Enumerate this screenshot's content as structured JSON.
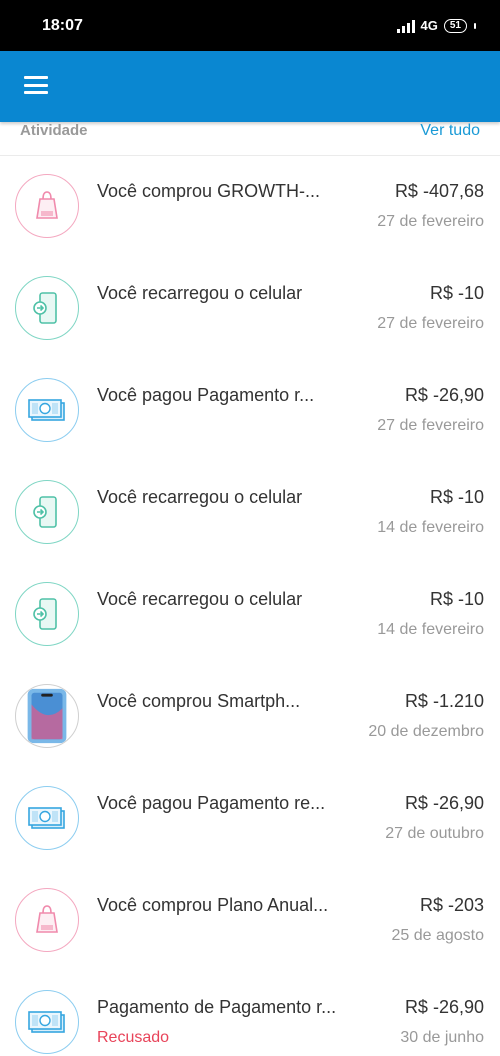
{
  "status_bar": {
    "time": "18:07",
    "network": "4G",
    "battery": "51"
  },
  "section": {
    "title": "Atividade",
    "see_all": "Ver tudo"
  },
  "colors": {
    "app_bar": "#0a87d1",
    "link": "#1a9ad6",
    "declined": "#e8445a",
    "shopping_icon": "#f4a8c0",
    "phone_recharge_icon": "#7fd6c4",
    "payment_icon": "#8ccdf0"
  },
  "activities": [
    {
      "icon": "shopping-bag-icon",
      "title": "Você comprou GROWTH-...",
      "amount": "R$ -407,68",
      "date": "27 de fevereiro",
      "status": ""
    },
    {
      "icon": "phone-recharge-icon",
      "title": "Você recarregou o celular",
      "amount": "R$ -10",
      "date": "27 de fevereiro",
      "status": ""
    },
    {
      "icon": "money-icon",
      "title": "Você pagou Pagamento r...",
      "amount": "R$ -26,90",
      "date": "27 de fevereiro",
      "status": ""
    },
    {
      "icon": "phone-recharge-icon",
      "title": "Você recarregou o celular",
      "amount": "R$ -10",
      "date": "14 de fevereiro",
      "status": ""
    },
    {
      "icon": "phone-recharge-icon",
      "title": "Você recarregou o celular",
      "amount": "R$ -10",
      "date": "14 de fevereiro",
      "status": ""
    },
    {
      "icon": "smartphone-product-image",
      "title": "Você comprou Smartph...",
      "amount": "R$ -1.210",
      "date": "20 de dezembro",
      "status": ""
    },
    {
      "icon": "money-icon",
      "title": "Você pagou Pagamento re...",
      "amount": "R$ -26,90",
      "date": "27 de outubro",
      "status": ""
    },
    {
      "icon": "shopping-bag-icon",
      "title": "Você comprou Plano Anual...",
      "amount": "R$ -203",
      "date": "25 de agosto",
      "status": ""
    },
    {
      "icon": "money-icon",
      "title": "Pagamento de Pagamento r...",
      "amount": "R$ -26,90",
      "date": "30 de junho",
      "status": "Recusado"
    }
  ]
}
